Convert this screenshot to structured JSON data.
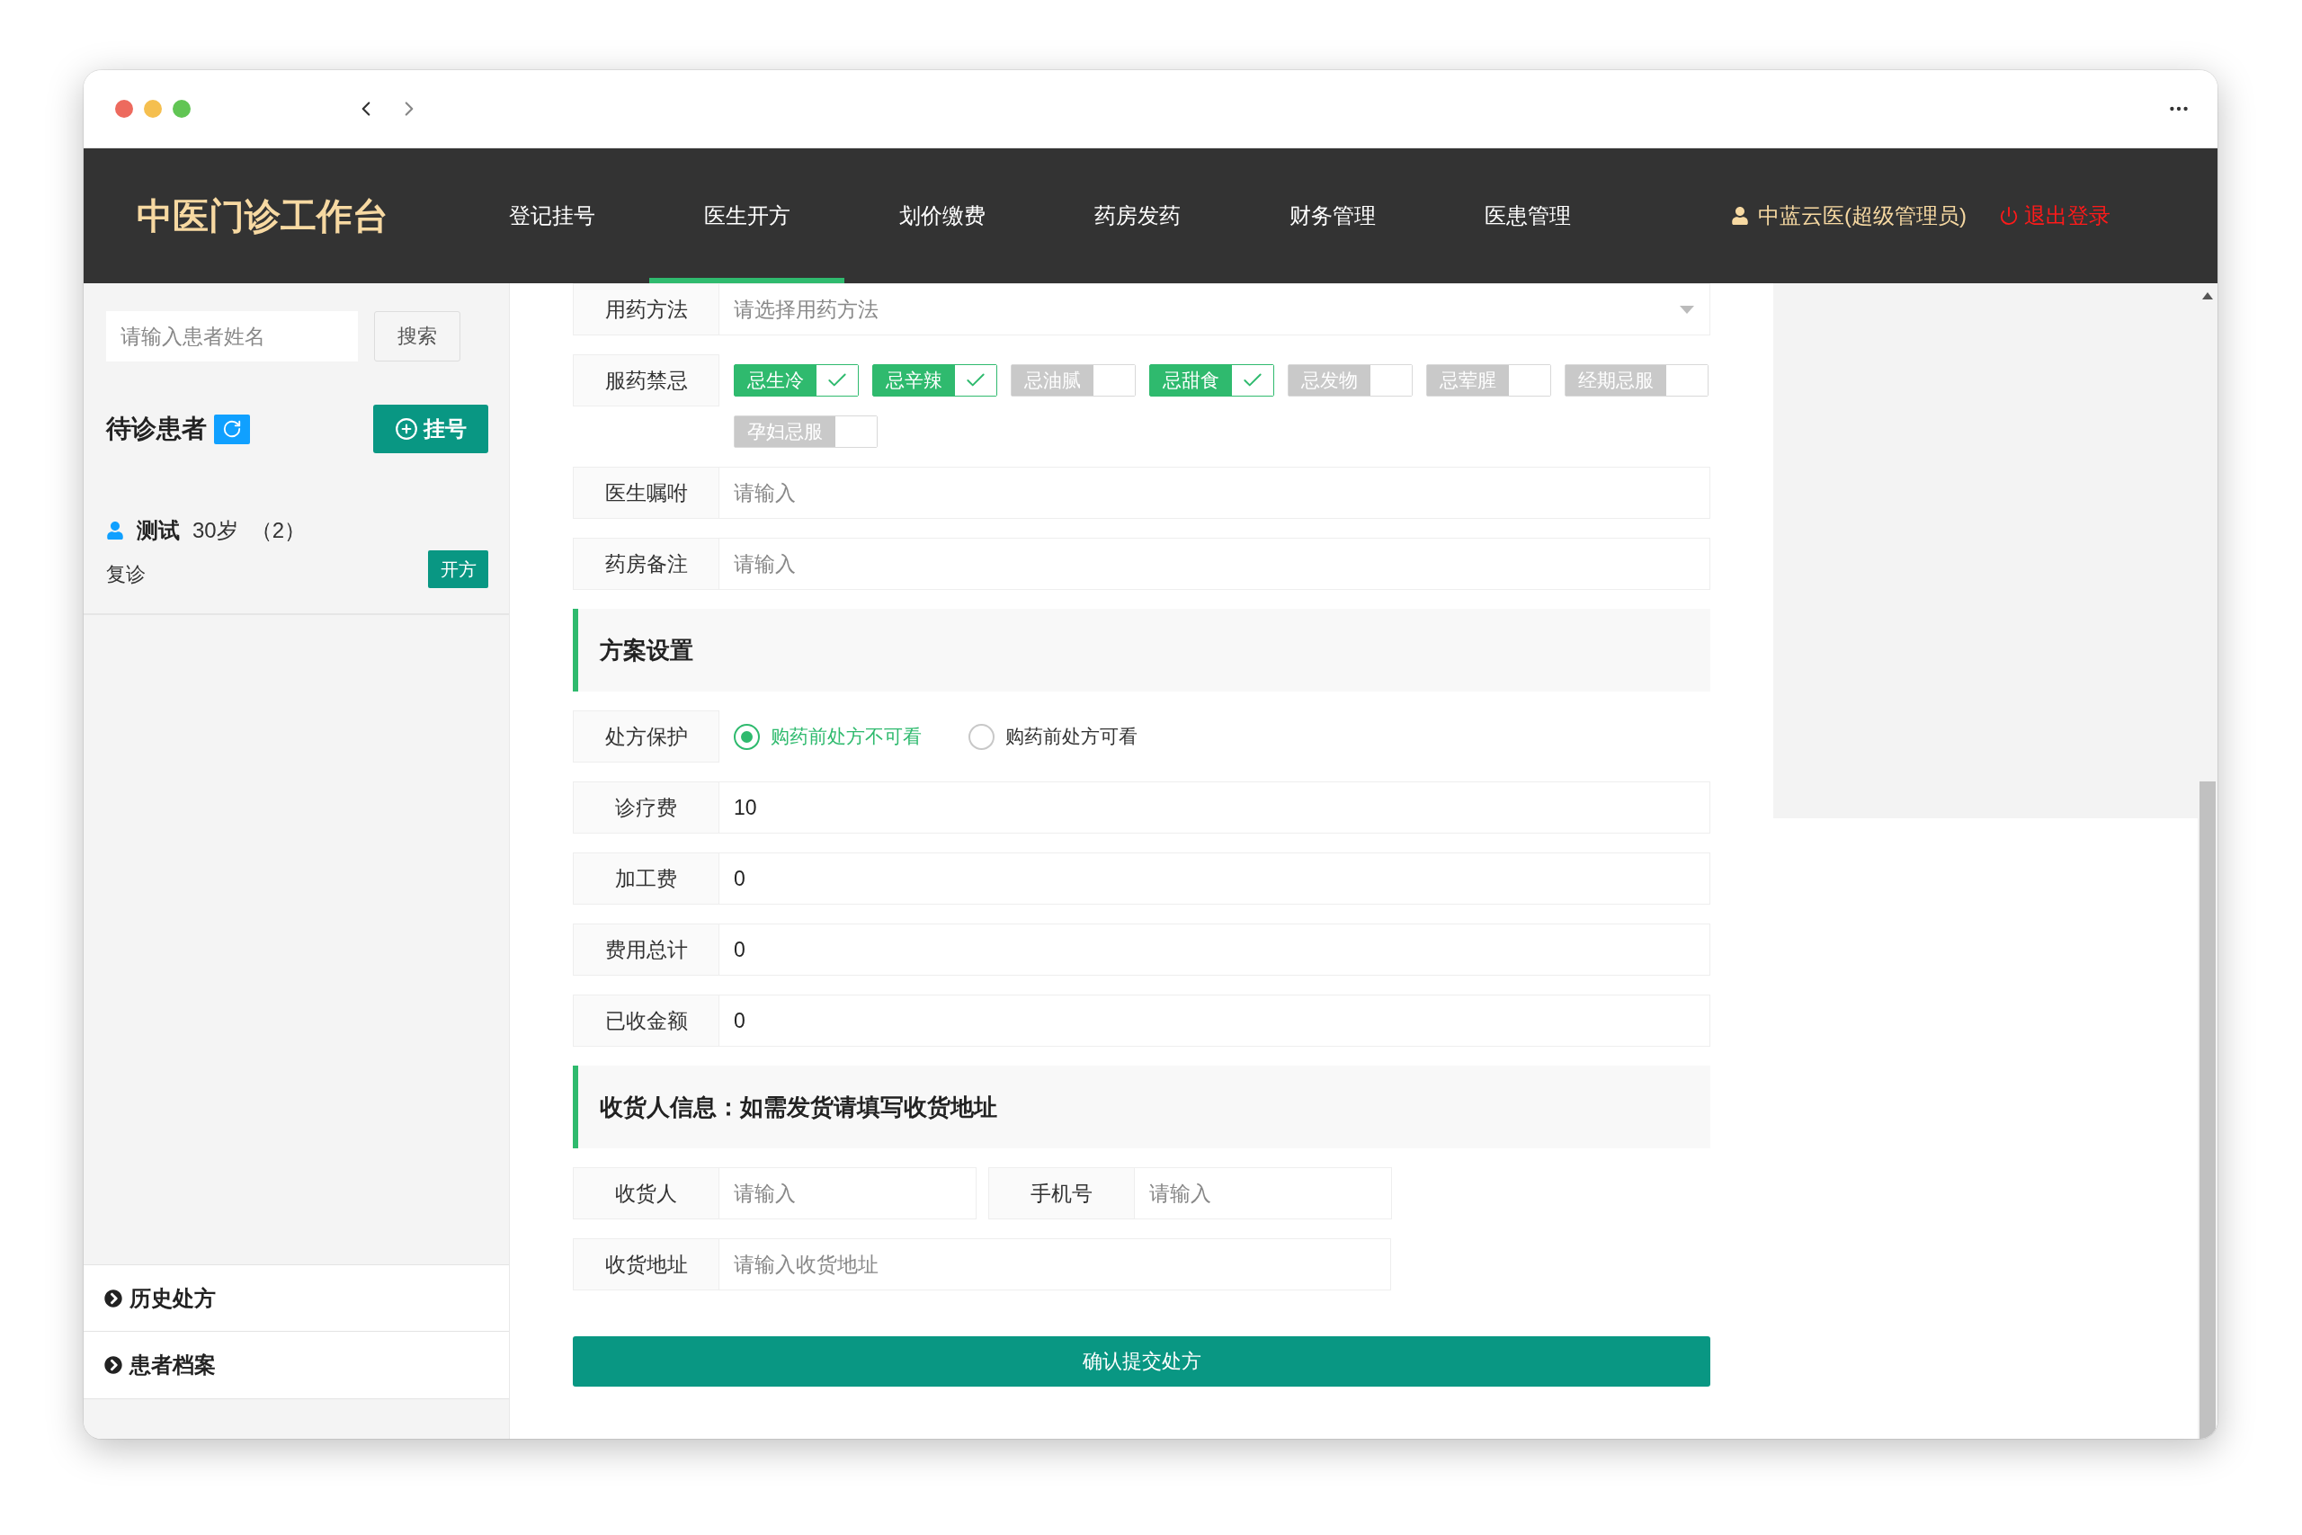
{
  "header": {
    "app_title": "中医门诊工作台",
    "nav": [
      {
        "label": "登记挂号",
        "selected": false
      },
      {
        "label": "医生开方",
        "selected": true
      },
      {
        "label": "划价缴费",
        "selected": false
      },
      {
        "label": "药房发药",
        "selected": false
      },
      {
        "label": "财务管理",
        "selected": false
      },
      {
        "label": "医患管理",
        "selected": false
      }
    ],
    "user": "中蓝云医(超级管理员)",
    "logout": "退出登录"
  },
  "sidebar": {
    "search": {
      "placeholder": "请输入患者姓名"
    },
    "search_button": "搜索",
    "waiting_title": "待诊患者",
    "register_button": "挂号",
    "patients": [
      {
        "name": "测试",
        "age": "30岁",
        "count": "（2）",
        "visit_type": "复诊",
        "action": "开方"
      }
    ],
    "links": [
      "历史处方",
      "患者档案"
    ]
  },
  "prescription": {
    "rows": [
      {
        "kind": "select",
        "label": "用药方法",
        "placeholder": "请选择用药方法"
      },
      {
        "kind": "tags",
        "label": "服药禁忌",
        "tags": [
          {
            "label": "忌生冷",
            "checked": true
          },
          {
            "label": "忌辛辣",
            "checked": true
          },
          {
            "label": "忌油腻",
            "checked": false
          },
          {
            "label": "忌甜食",
            "checked": true
          },
          {
            "label": "忌发物",
            "checked": false
          },
          {
            "label": "忌荤腥",
            "checked": false
          },
          {
            "label": "经期忌服",
            "checked": false
          },
          {
            "label": "孕妇忌服",
            "checked": false
          }
        ]
      },
      {
        "kind": "input",
        "label": "医生嘱咐",
        "placeholder": "请输入"
      },
      {
        "kind": "input",
        "label": "药房备注",
        "placeholder": "请输入"
      }
    ]
  },
  "plan": {
    "title": "方案设置",
    "protection": {
      "label": "处方保护",
      "options": [
        {
          "label": "购药前处方不可看",
          "selected": true
        },
        {
          "label": "购药前处方可看",
          "selected": false
        }
      ]
    },
    "fees": [
      {
        "label": "诊疗费",
        "value": "10"
      },
      {
        "label": "加工费",
        "value": "0"
      },
      {
        "label": "费用总计",
        "value": "0"
      },
      {
        "label": "已收金额",
        "value": "0"
      }
    ]
  },
  "receiver": {
    "title": "收货人信息：如需发货请填写收货地址",
    "contacts": [
      {
        "label": "收货人",
        "placeholder": "请输入"
      },
      {
        "label": "手机号",
        "placeholder": "请输入"
      }
    ],
    "address": {
      "label": "收货地址",
      "placeholder": "请输入收货地址"
    }
  },
  "submit_button": "确认提交处方"
}
